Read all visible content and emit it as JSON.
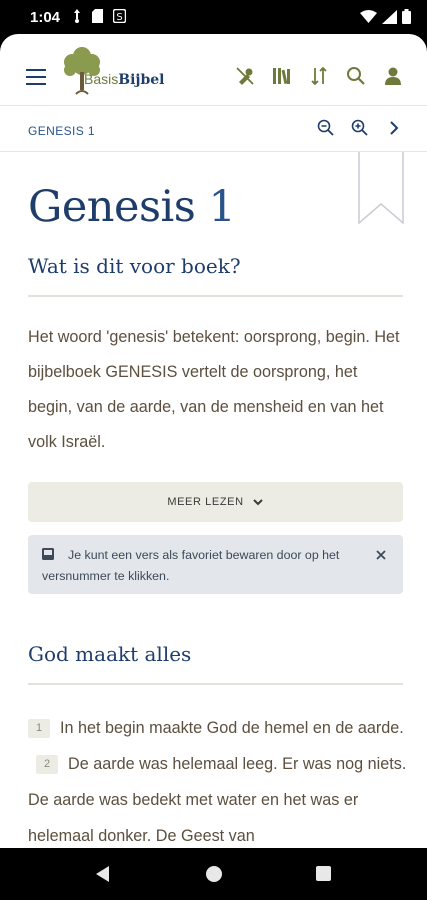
{
  "status": {
    "time": "1:04"
  },
  "app": {
    "logo_prefix": "Basis",
    "logo_suffix": "Bijbel"
  },
  "breadcrumb": "GENESIS 1",
  "chapter": {
    "book": "Genesis",
    "number": "1"
  },
  "intro": {
    "heading": "Wat is dit voor boek?",
    "text": "Het woord 'genesis' betekent: oorsprong, begin. Het bijbelboek GENESIS vertelt de oorsprong, het begin, van de aarde, van de mensheid en van het volk Israël.",
    "more_label": "MEER LEZEN"
  },
  "tip": {
    "text": "Je kunt een vers als favoriet bewaren door op het versnummer te klikken."
  },
  "section": {
    "heading": "God maakt alles",
    "verses": [
      {
        "num": "1",
        "text": "In het begin maakte God de hemel en de aarde."
      },
      {
        "num": "2",
        "text": "De aarde was helemaal leeg. Er was nog niets. De aarde was bedekt met water en het was er helemaal donker. De Geest van"
      }
    ]
  },
  "colors": {
    "accent": "#1f3d6b",
    "olive": "#6d7a3c",
    "text": "#5c4f3f"
  }
}
